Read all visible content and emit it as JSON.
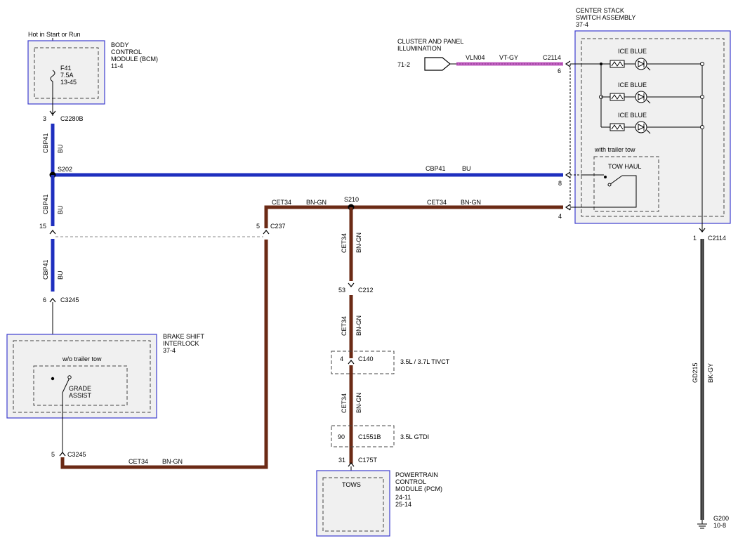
{
  "bcm": {
    "supply_label": "Hot in Start or Run",
    "title": [
      "BODY",
      "CONTROL",
      "MODULE (BCM)",
      "11-4"
    ],
    "fuse": [
      "F41",
      "7.5A",
      "13-45"
    ],
    "pin": "3",
    "connector": "C2280B"
  },
  "wire_cbp41_top": {
    "circuit": "CBP41",
    "color": "BU"
  },
  "splice_s202": "S202",
  "wire_s202_main": {
    "circuit": "CBP41",
    "color": "BU"
  },
  "wire_cbp41_mid": {
    "circuit": "CBP41",
    "color": "BU"
  },
  "c237": {
    "pin_left": "15",
    "pin_right": "5",
    "connector": "C237"
  },
  "wire_cbp41_low": {
    "circuit": "CBP41",
    "color": "BU"
  },
  "c3245_top": {
    "pin": "6",
    "connector": "C3245"
  },
  "brake_shift": {
    "title": [
      "BRAKE SHIFT",
      "INTERLOCK",
      "37-4"
    ],
    "variant": "w/o trailer tow",
    "switch_label": [
      "GRADE",
      "ASSIST"
    ]
  },
  "c3245_bottom": {
    "pin": "5",
    "connector": "C3245"
  },
  "wire_cet34_bottom": {
    "circuit": "CET34",
    "color": "BN-GN"
  },
  "wire_cet34_top": {
    "circuit": "CET34",
    "color": "BN-GN"
  },
  "splice_s210": "S210",
  "wire_cet34_right": {
    "circuit": "CET34",
    "color": "BN-GN"
  },
  "wire_cet34_v1": {
    "circuit": "CET34",
    "color": "BN-GN"
  },
  "c212": {
    "pin": "53",
    "connector": "C212"
  },
  "wire_cet34_v2": {
    "circuit": "CET34",
    "color": "BN-GN"
  },
  "c140": {
    "pin": "4",
    "connector": "C140",
    "note": "3.5L / 3.7L TIVCT"
  },
  "wire_cet34_v3": {
    "circuit": "CET34",
    "color": "BN-GN"
  },
  "c1551b": {
    "pin": "90",
    "connector": "C1551B",
    "note": "3.5L GTDI"
  },
  "c175t": {
    "pin": "31",
    "connector": "C175T"
  },
  "pcm": {
    "title": [
      "POWERTRAIN",
      "CONTROL",
      "MODULE (PCM)",
      "24-11",
      "25-14"
    ],
    "inner_label": "TOWS"
  },
  "cluster": {
    "title": [
      "CLUSTER AND PANEL",
      "ILLUMINATION"
    ],
    "ref": "71-2",
    "circuit": "VLN04",
    "color": "VT-GY",
    "connector": "C2114",
    "pin": "6"
  },
  "center_stack": {
    "title": [
      "CENTER STACK",
      "SWITCH ASSEMBLY",
      "37-4"
    ],
    "lamps": [
      "ICE BLUE",
      "ICE BLUE",
      "ICE BLUE"
    ],
    "variant": "with trailer tow",
    "switch_label": "TOW HAUL",
    "pin_8": "8",
    "pin_4": "4",
    "ground_pin": "1",
    "ground_connector": "C2114"
  },
  "wire_gd215": {
    "circuit": "GD215",
    "color": "BK-GY"
  },
  "ground": {
    "name": "G200",
    "ref": "10-8"
  },
  "colors": {
    "blue_wire": "#1e2fbf",
    "brown_wire": "#6b2a15",
    "violet_wire": "#c060c0",
    "black_wire": "#222222",
    "module_fill": "#f0f0f0",
    "module_border": "#3c3ccf"
  }
}
